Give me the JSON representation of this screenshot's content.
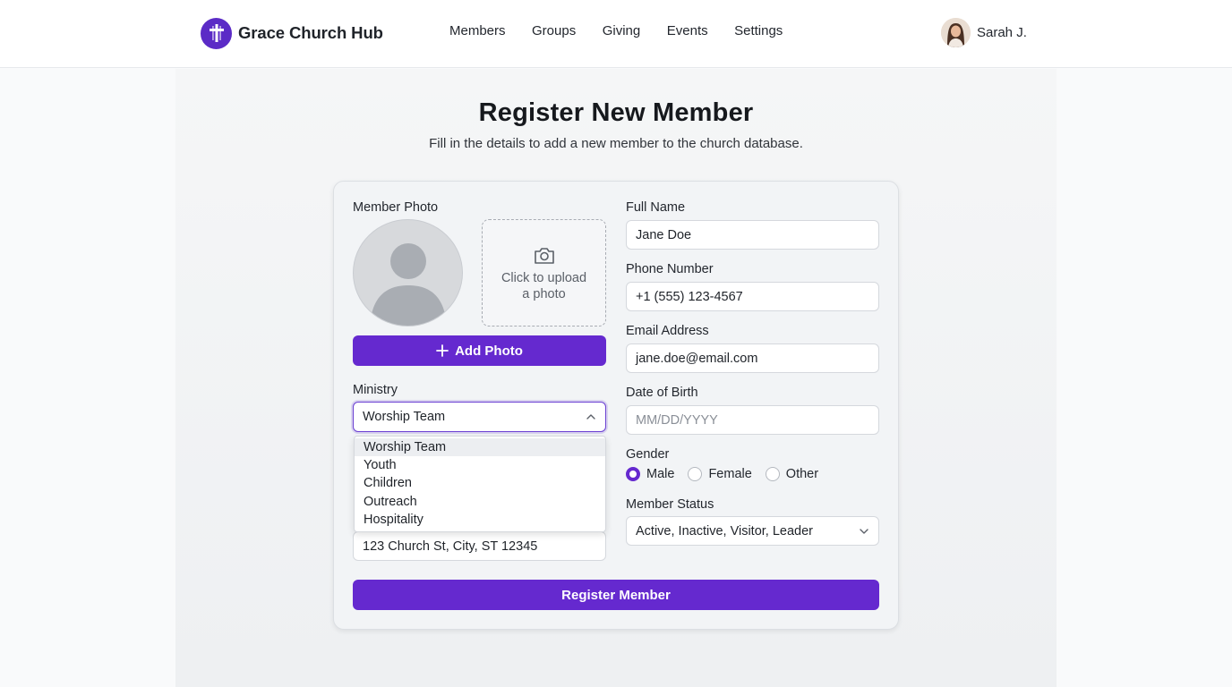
{
  "header": {
    "app_name": "Grace Church Hub",
    "nav": [
      "Members",
      "Groups",
      "Giving",
      "Events",
      "Settings"
    ],
    "user_name": "Sarah J."
  },
  "page": {
    "title": "Register New Member",
    "subtitle": "Fill in the details to add a new member to the church database."
  },
  "form": {
    "photo": {
      "label": "Member Photo",
      "upload_text_line1": "Click to upload",
      "upload_text_line2": "a photo",
      "add_button": "Add Photo"
    },
    "ministry": {
      "label": "Ministry",
      "selected": "Worship Team",
      "options": [
        "Worship Team",
        "Youth",
        "Children",
        "Outreach",
        "Hospitality"
      ]
    },
    "address": {
      "value": "123 Church St, City, ST 12345"
    },
    "full_name": {
      "label": "Full Name",
      "value": "Jane Doe"
    },
    "phone": {
      "label": "Phone Number",
      "value": "+1 (555) 123-4567"
    },
    "email": {
      "label": "Email Address",
      "value": "jane.doe@email.com"
    },
    "dob": {
      "label": "Date of Birth",
      "placeholder": "MM/DD/YYYY"
    },
    "gender": {
      "label": "Gender",
      "options": [
        "Male",
        "Female",
        "Other"
      ],
      "selected": "Male"
    },
    "status": {
      "label": "Member Status",
      "value": "Active, Inactive, Visitor, Leader"
    },
    "submit": "Register Member"
  },
  "colors": {
    "accent": "#6529cf",
    "logo": "#5b2bc6"
  },
  "icons": {
    "logo": "cross-icon",
    "upload": "camera-icon",
    "add": "plus-icon",
    "select_open": "chevron-up-icon",
    "select_closed": "chevron-down-icon"
  }
}
